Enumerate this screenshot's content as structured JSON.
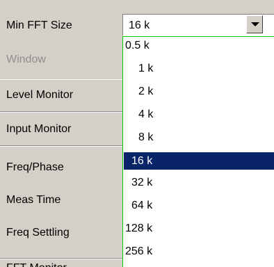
{
  "labels": {
    "min_fft_size": "Min FFT Size",
    "window": "Window",
    "level_monitor": "Level Monitor",
    "input_monitor": "Input Monitor",
    "freq_phase": "Freq/Phase",
    "meas_time": "Meas Time",
    "freq_settling": "Freq Settling",
    "fft_monitor": "FFT Monitor"
  },
  "combo": {
    "value": "16 k",
    "button_icon": "chevron-down-icon"
  },
  "dropdown": {
    "options": [
      "0.5 k",
      "1 k",
      "2 k",
      "4 k",
      "8 k",
      "16 k",
      "32 k",
      "64 k",
      "128 k",
      "256 k"
    ],
    "selected_index": 5
  },
  "colors": {
    "panel": "#d4d0c8",
    "selection": "#0a246a",
    "dropdown_border": "#00c800",
    "disabled_text": "#8e8e8e"
  }
}
